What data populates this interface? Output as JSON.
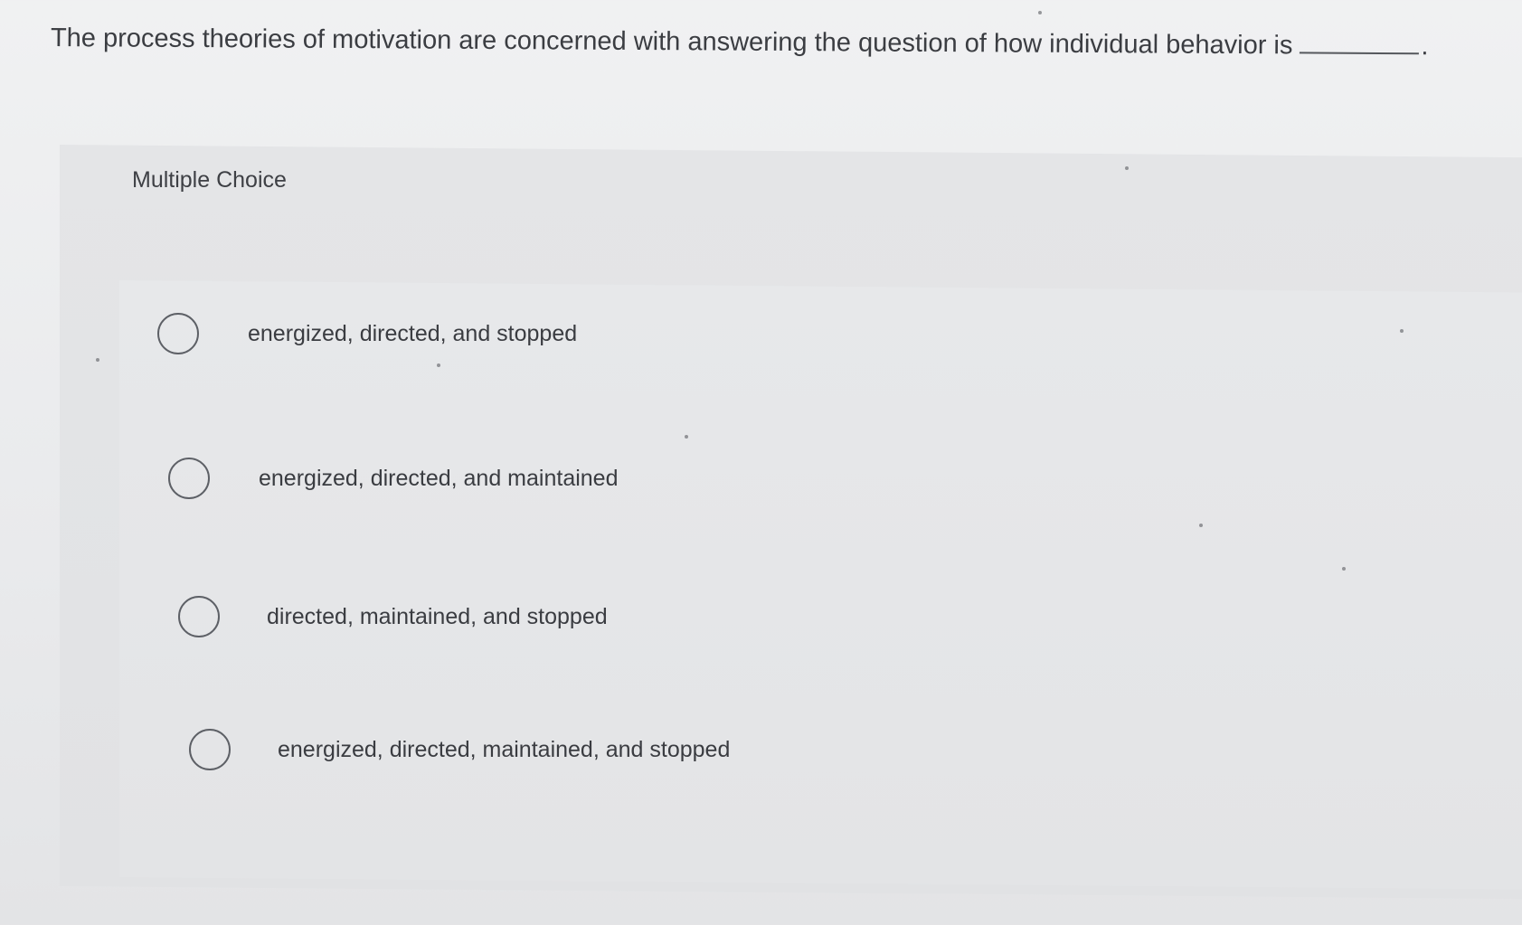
{
  "question": {
    "text": "The process theories of motivation are concerned with answering the question of how individual behavior is",
    "blank_suffix": "."
  },
  "multiple_choice": {
    "title": "Multiple Choice",
    "options": [
      {
        "label": "energized, directed, and stopped",
        "selected": false
      },
      {
        "label": "energized, directed, and maintained",
        "selected": false
      },
      {
        "label": "directed, maintained, and stopped",
        "selected": false
      },
      {
        "label": "energized, directed, maintained, and stopped",
        "selected": false
      }
    ]
  },
  "colors": {
    "background": "#eceded",
    "panel": "#e2e3e5",
    "text": "#3a3c40",
    "radio_border": "#5d6066"
  }
}
